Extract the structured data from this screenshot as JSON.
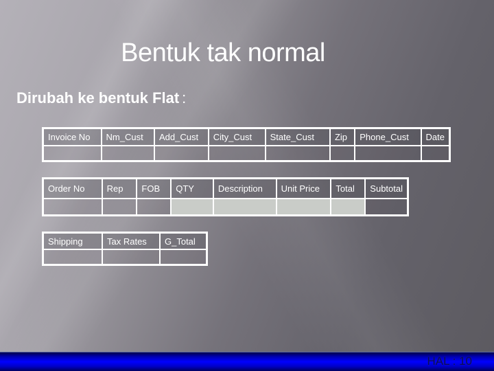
{
  "slide": {
    "title": "Bentuk tak normal",
    "subtitle": "Dirubah ke bentuk Flat",
    "subtitle_suffix": ":",
    "colors": {
      "text": "#ffffff",
      "table_border": "#ffffff",
      "highlight_cell": "#c9ccc8",
      "footer_bar": "#0000ff"
    }
  },
  "tables": [
    {
      "headers": [
        "Invoice No",
        "Nm_Cust",
        "Add_Cust",
        "City_Cust",
        "State_Cust",
        "Zip",
        "Phone_Cust",
        "Date"
      ],
      "values": [
        "",
        "",
        "",
        "",
        "",
        "",
        "",
        ""
      ]
    },
    {
      "headers": [
        "Order No",
        "Rep",
        "FOB",
        "QTY",
        "Description",
        "Unit Price",
        "Total",
        "Subtotal"
      ],
      "values": [
        "",
        "",
        "",
        "",
        "",
        "",
        "",
        ""
      ],
      "highlighted_value_cells": [
        "QTY",
        "Description",
        "Unit Price",
        "Total"
      ]
    },
    {
      "headers": [
        "Shipping",
        "Tax Rates",
        "G_Total"
      ],
      "values": [
        "",
        "",
        ""
      ]
    }
  ],
  "footer": {
    "page_label": "HAL : 10"
  }
}
